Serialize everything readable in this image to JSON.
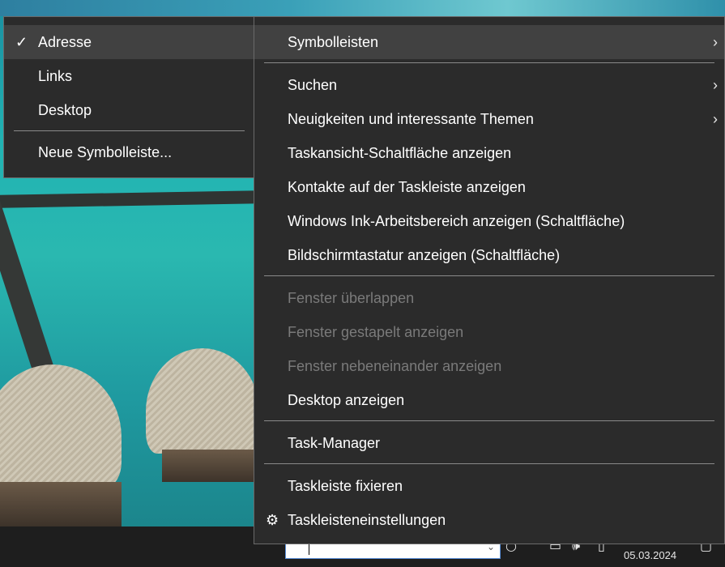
{
  "submenu": {
    "items": [
      {
        "label": "Adresse",
        "checked": true
      },
      {
        "label": "Links"
      },
      {
        "label": "Desktop"
      },
      {
        "label": "Neue Symbolleiste..."
      }
    ]
  },
  "context_menu": {
    "items": [
      {
        "label": "Symbolleisten",
        "has_submenu": true
      },
      {
        "label": "Suchen",
        "has_submenu": true
      },
      {
        "label": "Neuigkeiten und interessante Themen",
        "has_submenu": true
      },
      {
        "label": "Taskansicht-Schaltfläche anzeigen"
      },
      {
        "label": "Kontakte auf der Taskleiste anzeigen"
      },
      {
        "label": "Windows Ink-Arbeitsbereich anzeigen (Schaltfläche)"
      },
      {
        "label": "Bildschirmtastatur anzeigen (Schaltfläche)"
      },
      {
        "label": "Fenster überlappen",
        "disabled": true
      },
      {
        "label": "Fenster gestapelt anzeigen",
        "disabled": true
      },
      {
        "label": "Fenster nebeneinander anzeigen",
        "disabled": true
      },
      {
        "label": "Desktop anzeigen"
      },
      {
        "label": "Task-Manager"
      },
      {
        "label": "Taskleiste fixieren"
      },
      {
        "label": "Taskleisteneinstellungen",
        "icon": "gear-icon"
      }
    ]
  },
  "taskbar": {
    "date": "05.03.2024",
    "address_value": ""
  },
  "icons": {
    "check": "✓",
    "chevron": "›",
    "gear": "⚙"
  },
  "colors": {
    "menu_bg": "#2b2b2b",
    "highlight": "#414141",
    "disabled_text": "#7a7a7a"
  }
}
